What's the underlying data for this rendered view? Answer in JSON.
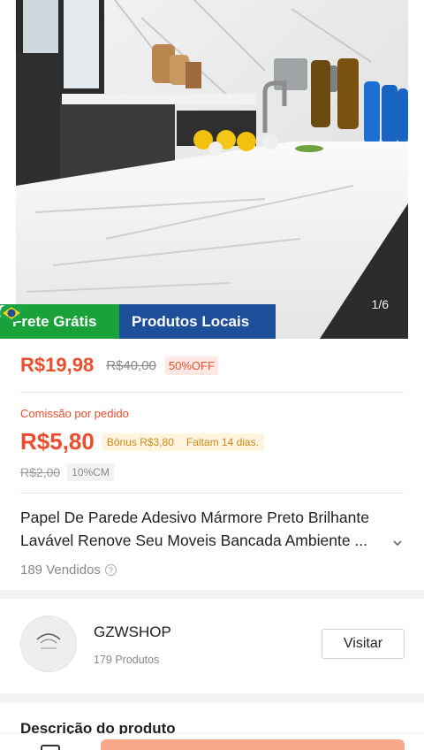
{
  "hero": {
    "image_counter": "1/6",
    "badges": {
      "free_shipping": "Frete Grátis",
      "local_products": "Produtos Locais"
    }
  },
  "price": {
    "current": "R$19,98",
    "original": "R$40,00",
    "discount": "50%OFF"
  },
  "commission": {
    "label": "Comissão por pedido",
    "value": "R$5,80",
    "bonus": "Bônus R$3,80",
    "remaining": "Faltam 14 dias.",
    "old_value": "R$2,00",
    "rate": "10%CM"
  },
  "product": {
    "title_line1": "Papel De Parede Adesivo Mármore Preto Brilhante",
    "title_line2": "Lavável Renove Seu Moveis Bancada Ambiente ...",
    "sold": "189 Vendidos"
  },
  "shop": {
    "name": "GZWSHOP",
    "products": "179 Produtos",
    "visit_label": "Visitar"
  },
  "description": {
    "title": "Descrição do produto"
  },
  "colors": {
    "accent": "#ee4d2d",
    "free_shipping_bg": "#19a23a",
    "local_products_bg": "#1d4f9a"
  },
  "icons": {
    "shipping": "truck-ticket-icon",
    "flag": "brazil-flag-icon",
    "expand": "chevron-down-icon",
    "help": "question-circle-icon"
  }
}
